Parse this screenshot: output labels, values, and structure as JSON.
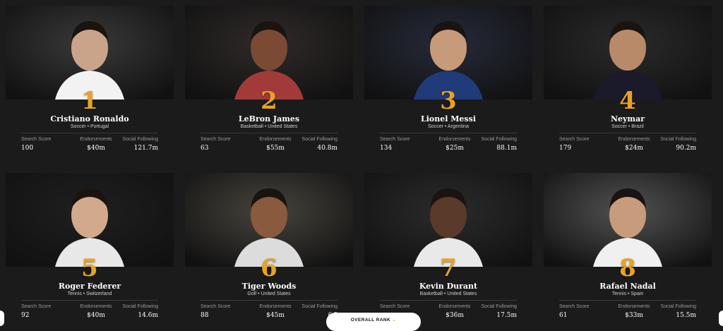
{
  "stat_labels": {
    "search": "Search Score",
    "endorse": "Endorsements",
    "social": "Social Following"
  },
  "athletes": [
    {
      "rank": "1",
      "name": "Cristiano Ronaldo",
      "sport_country": "Soccer • Portugal",
      "search": "100",
      "endorse": "$40m",
      "social": "121.7m"
    },
    {
      "rank": "2",
      "name": "LeBron James",
      "sport_country": "Basketball • United States",
      "search": "63",
      "endorse": "$55m",
      "social": "40.8m"
    },
    {
      "rank": "3",
      "name": "Lionel Messi",
      "sport_country": "Soccer • Argentina",
      "search": "134",
      "endorse": "$25m",
      "social": "88.1m"
    },
    {
      "rank": "4",
      "name": "Neymar",
      "sport_country": "Soccer • Brazil",
      "search": "179",
      "endorse": "$24m",
      "social": "90.2m"
    },
    {
      "rank": "5",
      "name": "Roger Federer",
      "sport_country": "Tennis • Switzerland",
      "search": "92",
      "endorse": "$40m",
      "social": "14.6m"
    },
    {
      "rank": "6",
      "name": "Tiger Woods",
      "sport_country": "Golf • United States",
      "search": "88",
      "endorse": "$45m",
      "social": "6.?"
    },
    {
      "rank": "7",
      "name": "Kevin Durant",
      "sport_country": "Basketball • United States",
      "search": "",
      "endorse": "$36m",
      "social": "17.5m"
    },
    {
      "rank": "8",
      "name": "Rafael Nadal",
      "sport_country": "Tennis • Spain",
      "search": "61",
      "endorse": "$33m",
      "social": "15.5m"
    }
  ],
  "sort_pill": {
    "label": "OVERALL RANK",
    "caret": "⌄"
  },
  "colors": {
    "background": "#1b1b1b",
    "rank_gold": "#e8a324"
  }
}
